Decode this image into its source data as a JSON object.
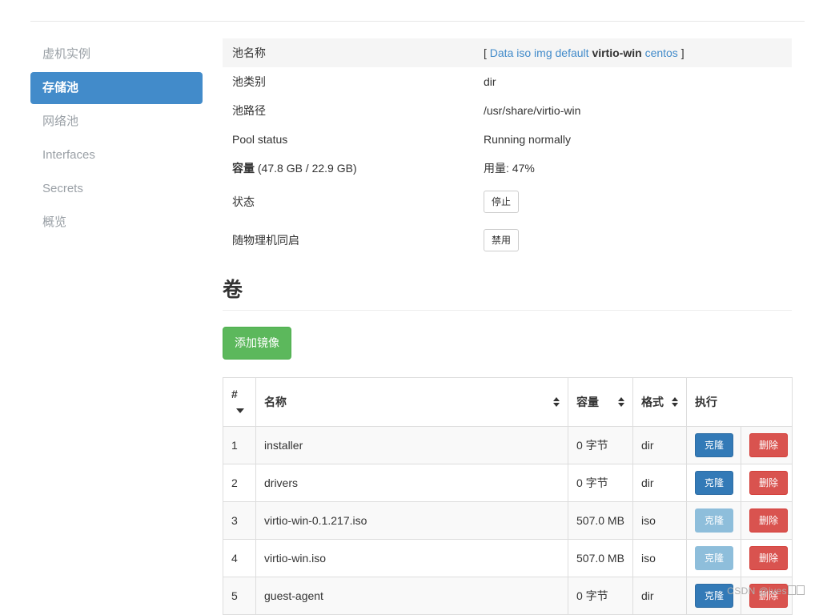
{
  "sidebar": {
    "items": [
      {
        "label": "虚机实例",
        "active": false
      },
      {
        "label": "存储池",
        "active": true
      },
      {
        "label": "网络池",
        "active": false
      },
      {
        "label": "Interfaces",
        "active": false
      },
      {
        "label": "Secrets",
        "active": false
      },
      {
        "label": "概览",
        "active": false
      }
    ]
  },
  "detail": {
    "pool_name_label": "池名称",
    "pool_links_open": "[",
    "pool_links_close": "]",
    "pool_links": [
      {
        "label": "Data",
        "current": false
      },
      {
        "label": "iso",
        "current": false
      },
      {
        "label": "img",
        "current": false
      },
      {
        "label": "default",
        "current": false
      },
      {
        "label": "virtio-win",
        "current": true
      },
      {
        "label": "centos",
        "current": false
      }
    ],
    "pool_type_label": "池类别",
    "pool_type_value": "dir",
    "pool_path_label": "池路径",
    "pool_path_value": "/usr/share/virtio-win",
    "pool_status_label": "Pool status",
    "pool_status_value": "Running normally",
    "capacity_label_bold": "容量",
    "capacity_label_rest": " (47.8 GB / 22.9 GB)",
    "capacity_value": "用量: 47%",
    "state_label": "状态",
    "state_button": "停止",
    "autostart_label": "随物理机同启",
    "autostart_button": "禁用"
  },
  "volumes": {
    "heading": "卷",
    "add_button": "添加镜像",
    "columns": {
      "num": "#",
      "name": "名称",
      "capacity": "容量",
      "format": "格式",
      "action": "执行"
    },
    "rows": [
      {
        "num": "1",
        "name": "installer",
        "capacity": "0 字节",
        "format": "dir",
        "clone": "克隆",
        "delete": "删除",
        "clone_disabled": false
      },
      {
        "num": "2",
        "name": "drivers",
        "capacity": "0 字节",
        "format": "dir",
        "clone": "克隆",
        "delete": "删除",
        "clone_disabled": false
      },
      {
        "num": "3",
        "name": "virtio-win-0.1.217.iso",
        "capacity": "507.0 MB",
        "format": "iso",
        "clone": "克隆",
        "delete": "删除",
        "clone_disabled": true
      },
      {
        "num": "4",
        "name": "virtio-win.iso",
        "capacity": "507.0 MB",
        "format": "iso",
        "clone": "克隆",
        "delete": "删除",
        "clone_disabled": true
      },
      {
        "num": "5",
        "name": "guest-agent",
        "capacity": "0 字节",
        "format": "dir",
        "clone": "克隆",
        "delete": "删除",
        "clone_disabled": false
      }
    ]
  },
  "watermark": {
    "text": "CSDN @ives"
  },
  "colors": {
    "accent_blue": "#428bca",
    "primary_blue": "#337ab7",
    "primary_blue_disabled": "#8ebedb",
    "success_green": "#5cb85c",
    "danger_red": "#d9534f",
    "striped_row": "#f5f5f5",
    "table_border": "#dddddd"
  }
}
